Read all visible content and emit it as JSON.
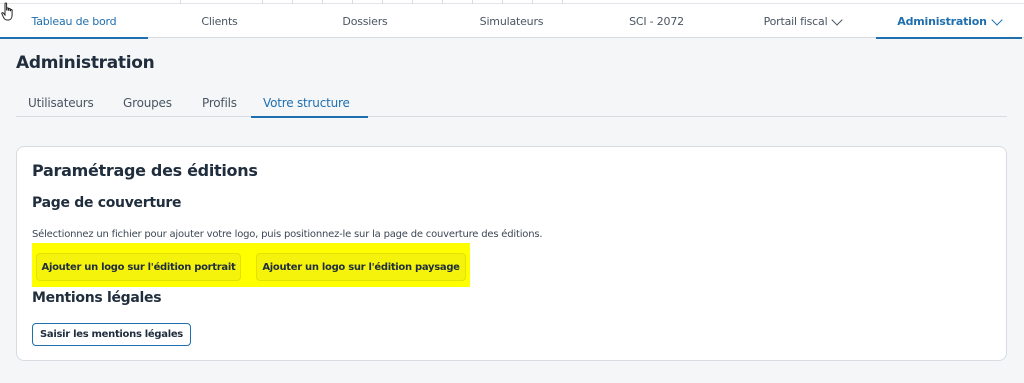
{
  "nav": {
    "tabs": [
      {
        "label": "Tableau de bord"
      },
      {
        "label": "Clients"
      },
      {
        "label": "Dossiers"
      },
      {
        "label": "Simulateurs"
      },
      {
        "label": "SCI - 2072"
      },
      {
        "label": "Portail fiscal"
      },
      {
        "label": "Administration"
      }
    ]
  },
  "page": {
    "title": "Administration"
  },
  "subtabs": [
    {
      "label": "Utilisateurs"
    },
    {
      "label": "Groupes"
    },
    {
      "label": "Profils"
    },
    {
      "label": "Votre structure"
    }
  ],
  "card": {
    "title": "Paramétrage des éditions",
    "cover": {
      "title": "Page de couverture",
      "description": "Sélectionnez un fichier pour ajouter votre logo, puis positionnez-le sur la page de couverture des éditions.",
      "btn_portrait": "Ajouter un logo sur l'édition portrait",
      "btn_landscape": "Ajouter un logo sur l'édition paysage"
    },
    "legal": {
      "title": "Mentions légales",
      "btn_label": "Saisir les mentions légales"
    }
  },
  "colors": {
    "accent": "#1f6fae",
    "highlight": "#ffff00",
    "text": "#1f2d3d"
  },
  "icons": {
    "cursor": "hand-pointer-icon",
    "dropdown": "chevron-down-icon"
  }
}
